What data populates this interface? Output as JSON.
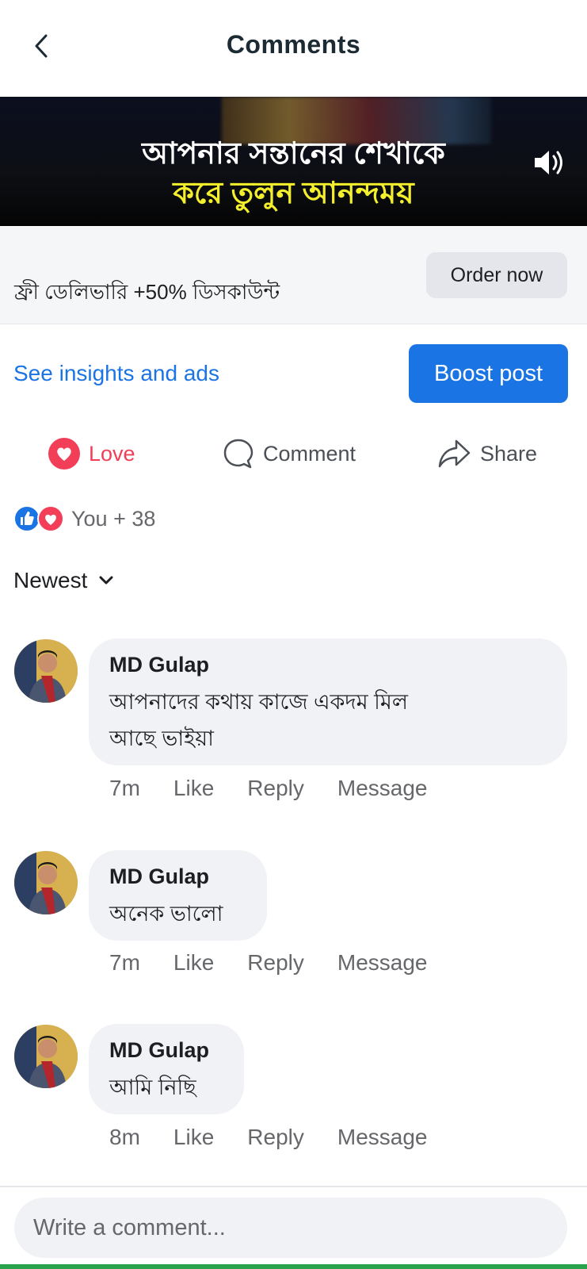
{
  "header": {
    "title": "Comments"
  },
  "video": {
    "line1": "আপনার সন্তানের শেখাকে",
    "line2": "করে তুলুন আনন্দময়"
  },
  "ad": {
    "promo_text": "ফ্রী ডেলিভারি +50% ডিসকাউন্ট",
    "order_label": "Order now"
  },
  "insights": {
    "link_label": "See insights and ads",
    "boost_label": "Boost post"
  },
  "actions": {
    "love": "Love",
    "comment": "Comment",
    "share": "Share"
  },
  "reactions": {
    "summary": "You + 38"
  },
  "sort": {
    "label": "Newest"
  },
  "comments": [
    {
      "author": "MD Gulap",
      "text_line1": "আপনাদের কথায় কাজে একদম মিল",
      "text_line2": "আছে ভাইয়া",
      "time": "7m",
      "like": "Like",
      "reply": "Reply",
      "message": "Message"
    },
    {
      "author": "MD Gulap",
      "text_line1": "অনেক ভালো",
      "time": "7m",
      "like": "Like",
      "reply": "Reply",
      "message": "Message"
    },
    {
      "author": "MD Gulap",
      "text_line1": "আমি নিছি",
      "time": "8m",
      "like": "Like",
      "reply": "Reply",
      "message": "Message"
    }
  ],
  "composer": {
    "placeholder": "Write a comment..."
  },
  "colors": {
    "accent": "#1b74e4",
    "love": "#f33e58",
    "bubble": "#f0f2f5",
    "muted": "#65676b"
  }
}
